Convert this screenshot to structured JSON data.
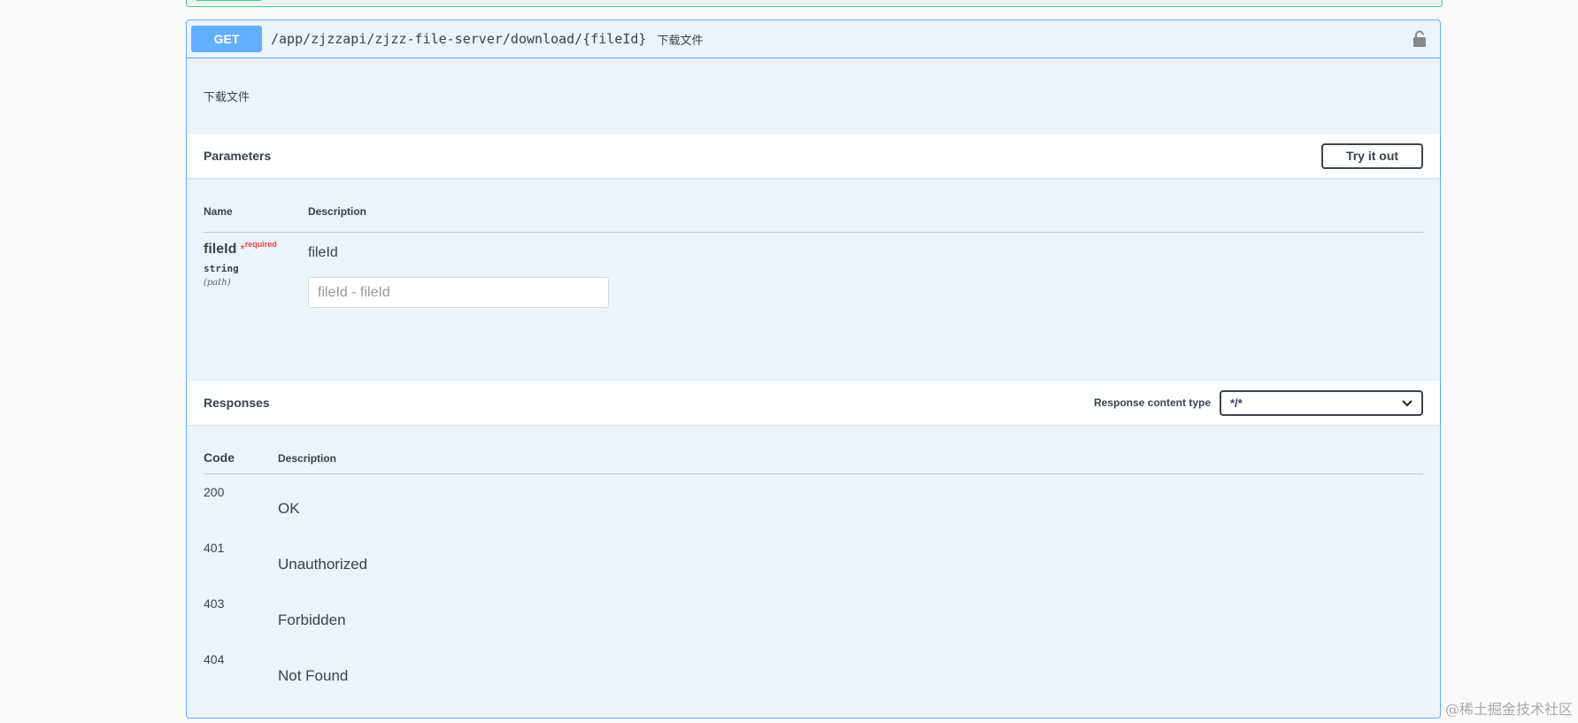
{
  "operation": {
    "method": "GET",
    "path": "/app/zjzzapi/zjzz-file-server/download/{fileId}",
    "summary": "下载文件",
    "description": "下载文件"
  },
  "parameters": {
    "title": "Parameters",
    "try_button": "Try it out",
    "col_name": "Name",
    "col_description": "Description",
    "items": [
      {
        "name": "fileId",
        "star": "*",
        "required": "required",
        "type": "string",
        "in": "(path)",
        "description": "fileId",
        "placeholder": "fileId - fileId"
      }
    ]
  },
  "responses": {
    "title": "Responses",
    "content_type_label": "Response content type",
    "content_type_value": "*/*",
    "col_code": "Code",
    "col_description": "Description",
    "items": [
      {
        "code": "200",
        "description": "OK"
      },
      {
        "code": "401",
        "description": "Unauthorized"
      },
      {
        "code": "403",
        "description": "Forbidden"
      },
      {
        "code": "404",
        "description": "Not Found"
      }
    ]
  },
  "watermark": "@稀土掘金技术社区",
  "icons": {
    "lock": "lock-icon",
    "chevron": "chevron-down-icon"
  },
  "colors": {
    "get": "#61affe",
    "post_previous": "#49cc90",
    "required": "#f93e3e"
  }
}
